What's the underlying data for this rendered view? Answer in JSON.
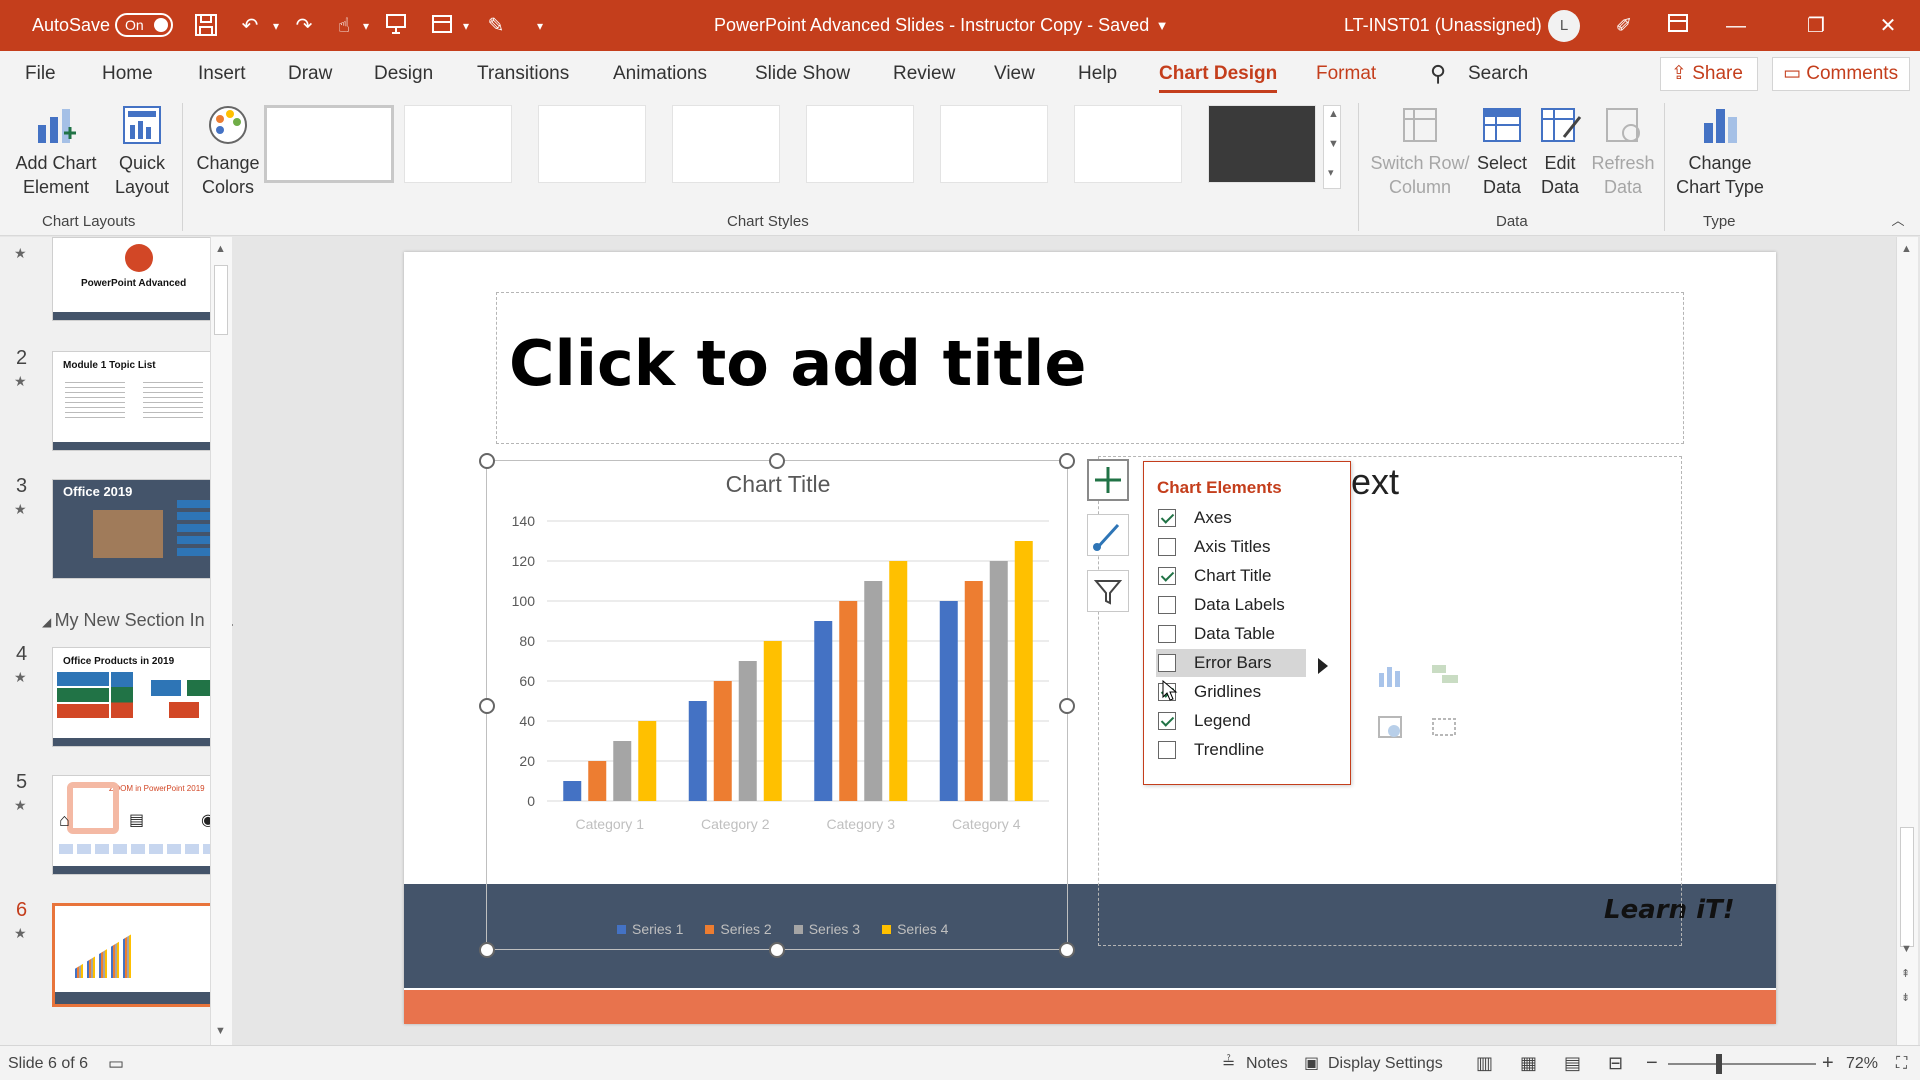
{
  "titlebar": {
    "autosave_label": "AutoSave",
    "autosave_state": "On",
    "doc_title": "PowerPoint Advanced Slides - Instructor Copy - Saved",
    "user": "LT-INST01 (Unassigned)",
    "avatar_initial": "L",
    "accent_color": "#c43e1c"
  },
  "tabs": {
    "items": [
      "File",
      "Home",
      "Insert",
      "Draw",
      "Design",
      "Transitions",
      "Animations",
      "Slide Show",
      "Review",
      "View",
      "Help",
      "Chart Design",
      "Format"
    ],
    "active": "Chart Design",
    "search_label": "Search",
    "share_label": "Share",
    "comments_label": "Comments"
  },
  "ribbon": {
    "add_chart_element": "Add Chart Element",
    "add_chart_line1": "Add Chart",
    "add_chart_line2": "Element",
    "quick_layout_line1": "Quick",
    "quick_layout_line2": "Layout",
    "change_colors_line1": "Change",
    "change_colors_line2": "Colors",
    "group_chart_layouts": "Chart Layouts",
    "group_chart_styles": "Chart Styles",
    "switch_row_line1": "Switch Row/",
    "switch_row_line2": "Column",
    "select_data_line1": "Select",
    "select_data_line2": "Data",
    "edit_data_line1": "Edit",
    "edit_data_line2": "Data",
    "refresh_data_line1": "Refresh",
    "refresh_data_line2": "Data",
    "group_data": "Data",
    "change_chart_type_line1": "Change",
    "change_chart_type_line2": "Chart Type",
    "group_type": "Type"
  },
  "slides_panel": {
    "slide1_title": "PowerPoint Advanced",
    "slide2_title": "Module 1 Topic List",
    "slide3_title": "Office 2019",
    "section_label": "My New Section In P...",
    "slide4_title": "Office Products in 2019",
    "slide5_title": "ZOOM in PowerPoint 2019",
    "numbers": [
      "2",
      "3",
      "4",
      "5",
      "6"
    ]
  },
  "slide": {
    "title_placeholder": "Click to add title",
    "content_placeholder_partial": "ext",
    "footer_brand": "Learn iT!"
  },
  "chart_data": {
    "type": "bar",
    "title": "Chart Title",
    "ylim": [
      0,
      140
    ],
    "yticks": [
      0,
      20,
      40,
      60,
      80,
      100,
      120,
      140
    ],
    "categories": [
      "Category 1",
      "Category 2",
      "Category 3",
      "Category 4"
    ],
    "series": [
      {
        "name": "Series 1",
        "color": "#4472c4",
        "values": [
          10,
          50,
          90,
          100
        ]
      },
      {
        "name": "Series 2",
        "color": "#ed7d31",
        "values": [
          20,
          60,
          100,
          110
        ]
      },
      {
        "name": "Series 3",
        "color": "#a5a5a5",
        "values": [
          30,
          70,
          110,
          120
        ]
      },
      {
        "name": "Series 4",
        "color": "#ffc000",
        "values": [
          40,
          80,
          120,
          130
        ]
      }
    ],
    "grid": true,
    "legend": "bottom"
  },
  "chart_elements": {
    "header": "Chart Elements",
    "items": [
      {
        "label": "Axes",
        "checked": true
      },
      {
        "label": "Axis Titles",
        "checked": false
      },
      {
        "label": "Chart Title",
        "checked": true
      },
      {
        "label": "Data Labels",
        "checked": false
      },
      {
        "label": "Data Table",
        "checked": false
      },
      {
        "label": "Error Bars",
        "checked": false
      },
      {
        "label": "Gridlines",
        "checked": true
      },
      {
        "label": "Legend",
        "checked": true
      },
      {
        "label": "Trendline",
        "checked": false
      }
    ],
    "hovered": "Error Bars"
  },
  "statusbar": {
    "slide_info": "Slide 6 of 6",
    "notes": "Notes",
    "display_settings": "Display Settings",
    "zoom": "72%"
  }
}
